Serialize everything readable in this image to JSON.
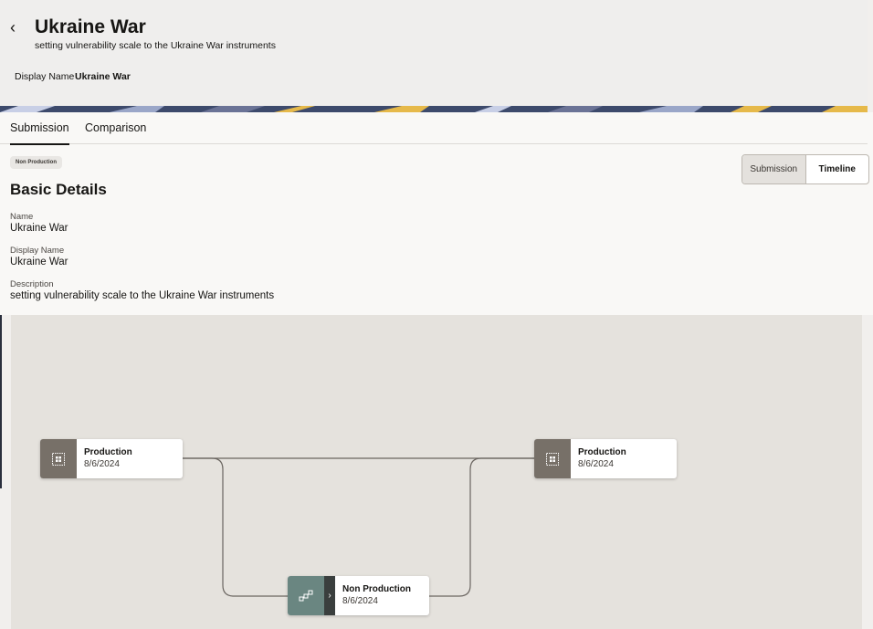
{
  "header": {
    "back_icon": "chevron-left-icon",
    "title": "Ukraine War",
    "subtitle": "setting vulnerability scale to the Ukraine War instruments",
    "display_name_label": "Display Name",
    "display_name_value": "Ukraine War"
  },
  "tabs": [
    {
      "label": "Submission",
      "active": true
    },
    {
      "label": "Comparison",
      "active": false
    }
  ],
  "badge": "Non Production",
  "view_toggle": {
    "options": [
      "Submission",
      "Timeline"
    ],
    "selected": "Submission"
  },
  "basic_details": {
    "title": "Basic Details",
    "fields": [
      {
        "label": "Name",
        "value": "Ukraine War"
      },
      {
        "label": "Display Name",
        "value": "Ukraine War"
      },
      {
        "label": "Description",
        "value": "setting vulnerability scale to the Ukraine War instruments"
      }
    ]
  },
  "diagram": {
    "nodes": [
      {
        "name": "Production",
        "date": "8/6/2024",
        "icon": "grid-icon"
      },
      {
        "name": "Production",
        "date": "8/6/2024",
        "icon": "grid-icon"
      },
      {
        "name": "Non Production",
        "date": "8/6/2024",
        "icon": "nodes-icon"
      }
    ]
  },
  "colors": {
    "accent_dark": "#161513",
    "node_icon_bg": "#777068",
    "node_np_icon_bg": "#6a8681",
    "diagram_bg": "#e5e2dd",
    "banner_navy": "#3d4a6c",
    "banner_yellow": "#e6b94a"
  }
}
